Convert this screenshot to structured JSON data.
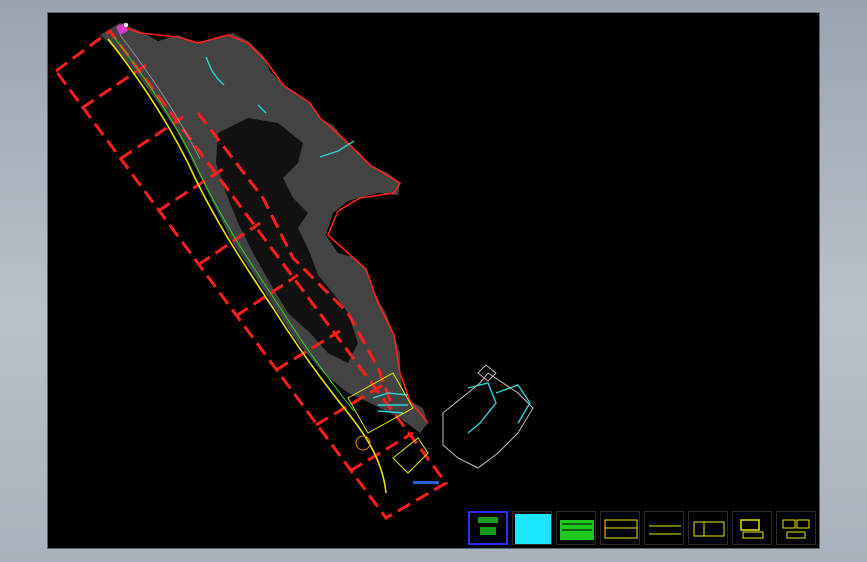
{
  "viewport": {
    "background": "#000000",
    "chrome_gradient": [
      "#9aa4b0",
      "#b9c1ca"
    ]
  },
  "drawing": {
    "colors": {
      "boundary": "#ff1e1e",
      "terrain": "#8c8c8c",
      "road": "#e6e600",
      "road_green": "#2bd62b",
      "water": "#29d3d3",
      "building": "#bfbfbf",
      "marker": "#d23cd2"
    },
    "zone_count": 9
  },
  "layout_sheets": [
    {
      "name": "sheet-1",
      "accent": "#1a9a1a",
      "selected": true,
      "label": ""
    },
    {
      "name": "sheet-2",
      "accent": "#19e6ff",
      "selected": false,
      "label": ""
    },
    {
      "name": "sheet-3",
      "accent": "#1fc81f",
      "selected": false,
      "label": ""
    },
    {
      "name": "sheet-4",
      "accent": "#e6e600",
      "selected": false,
      "label": ""
    },
    {
      "name": "sheet-5",
      "accent": "#e6e600",
      "selected": false,
      "label": ""
    },
    {
      "name": "sheet-6",
      "accent": "#e6e600",
      "selected": false,
      "label": ""
    },
    {
      "name": "sheet-7",
      "accent": "#e6e600",
      "selected": false,
      "label": ""
    },
    {
      "name": "sheet-8",
      "accent": "#e6e600",
      "selected": false,
      "label": ""
    }
  ]
}
